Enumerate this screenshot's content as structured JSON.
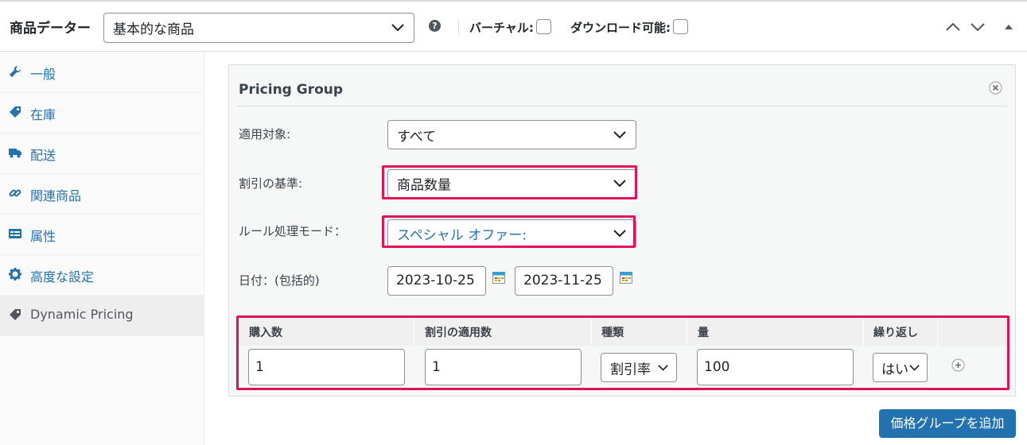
{
  "header": {
    "title": "商品データー",
    "product_type": "基本的な商品",
    "help_icon": "?",
    "virtual_label": "バーチャル:",
    "downloadable_label": "ダウンロード可能:",
    "virtual_checked": false,
    "downloadable_checked": false
  },
  "sidebar": {
    "items": [
      {
        "label": "一般",
        "icon": "wrench-icon"
      },
      {
        "label": "在庫",
        "icon": "tag-icon"
      },
      {
        "label": "配送",
        "icon": "truck-icon"
      },
      {
        "label": "関連商品",
        "icon": "link-icon"
      },
      {
        "label": "属性",
        "icon": "list-icon"
      },
      {
        "label": "高度な設定",
        "icon": "gear-icon"
      },
      {
        "label": "Dynamic Pricing",
        "icon": "tag-icon",
        "active": true
      }
    ]
  },
  "pricing_group": {
    "title": "Pricing Group",
    "apply_to": {
      "label": "適用対象:",
      "value": "すべて"
    },
    "discount_basis": {
      "label": "割引の基準:",
      "value": "商品数量"
    },
    "rule_mode": {
      "label": "ルール処理モード：",
      "value": "スペシャル オファー:"
    },
    "dates": {
      "label": "日付：(包括的)",
      "from": "2023-10-25",
      "to": "2023-11-25"
    },
    "table": {
      "headers": [
        "購入数",
        "割引の適用数",
        "種類",
        "量",
        "繰り返し"
      ],
      "row": {
        "purchase_qty": "1",
        "apply_qty": "1",
        "type": "割引率",
        "amount": "100",
        "repeat": "はい"
      }
    }
  },
  "add_group_button": "価格グループを追加",
  "colors": {
    "accent": "#2271b1",
    "highlight": "#e2125a"
  }
}
